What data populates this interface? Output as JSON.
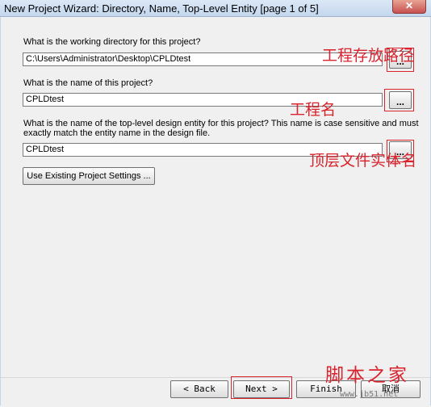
{
  "window": {
    "title": "New Project Wizard: Directory, Name, Top-Level Entity [page 1 of 5]"
  },
  "fields": {
    "directory": {
      "label": "What is the working directory for this project?",
      "value": "C:\\Users\\Administrator\\Desktop\\CPLDtest"
    },
    "project_name": {
      "label": "What is the name of this project?",
      "value": "CPLDtest"
    },
    "top_level": {
      "label_line1": "What is the name of the top-level design entity for this project? This name is case sensitive and must",
      "label_line2": "exactly match the entity name in the design file.",
      "value": "CPLDtest"
    },
    "browse_label": "..."
  },
  "buttons": {
    "use_existing": "Use Existing Project Settings ...",
    "back": "< Back",
    "next": "Next >",
    "finish": "Finish",
    "cancel": "取消"
  },
  "annotations": {
    "directory": "工程存放路径",
    "project_name": "工程名",
    "top_level": "顶层文件实体名"
  },
  "watermark": {
    "text": "脚本之家",
    "url": "www.jb51.net"
  },
  "colors": {
    "annotation": "#d9232d",
    "background": "#f0f0f0"
  }
}
